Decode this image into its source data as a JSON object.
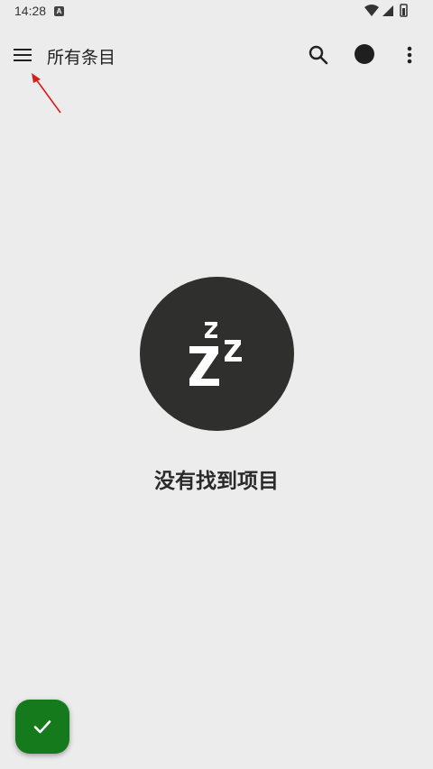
{
  "status_bar": {
    "time": "14:28",
    "notification_letter": "A"
  },
  "app_bar": {
    "title": "所有条目"
  },
  "empty_state": {
    "message": "没有找到项目",
    "icon": "sleep-zzz-icon"
  },
  "fab": {
    "icon": "check-icon"
  },
  "colors": {
    "background": "#ececec",
    "illustration_circle": "#2f302d",
    "fab": "#157a1c",
    "arrow_annotation": "#d71e1e"
  }
}
